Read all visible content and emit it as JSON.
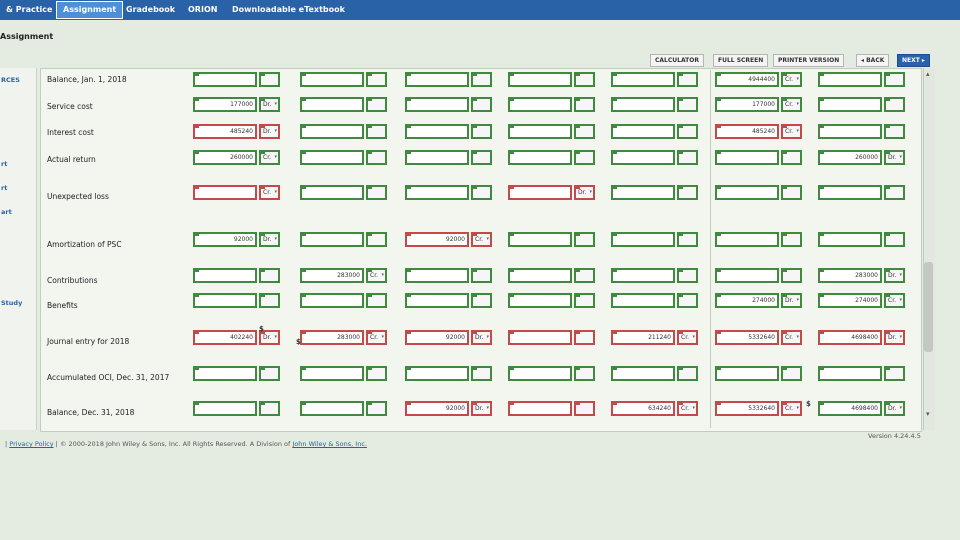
{
  "nav": {
    "tabs": [
      "& Practice",
      "Assignment",
      "Gradebook",
      "ORION",
      "Downloadable eTextbook"
    ],
    "active_tab": "Assignment"
  },
  "page_title": "Assignment",
  "toolbar": {
    "calculator": "CALCULATOR",
    "full_screen": "FULL SCREEN",
    "printer_version": "PRINTER VERSION",
    "back": "◂ BACK",
    "next": "NEXT ▸"
  },
  "sidebar": {
    "items": [
      "RCES",
      "rt",
      "rt",
      "art",
      "Study"
    ]
  },
  "worksheet": {
    "row_labels": [
      "Balance, Jan. 1, 2018",
      "Service cost",
      "Interest cost",
      "Actual return",
      "Unexpected loss",
      "Amortization of PSC",
      "Contributions",
      "Benefits",
      "Journal entry for 2018",
      "Accumulated OCI, Dec. 31, 2017",
      "Balance, Dec. 31, 2018"
    ],
    "entries": [
      {
        "row": 0,
        "column": "pbo",
        "value": "4944400",
        "side": "Cr."
      },
      {
        "row": 1,
        "column": "pension_expense",
        "value": "177000",
        "side": "Dr."
      },
      {
        "row": 1,
        "column": "pbo",
        "value": "177000",
        "side": "Cr."
      },
      {
        "row": 2,
        "column": "pension_expense",
        "value": "485240",
        "side": "Dr."
      },
      {
        "row": 2,
        "column": "pbo",
        "value": "485240",
        "side": "Cr."
      },
      {
        "row": 3,
        "column": "pension_expense",
        "value": "260000",
        "side": "Cr."
      },
      {
        "row": 3,
        "column": "plan_assets",
        "value": "260000",
        "side": "Dr."
      },
      {
        "row": 4,
        "column": "pension_expense",
        "value": "",
        "side": "Cr."
      },
      {
        "row": 4,
        "column": "oci_gain_loss",
        "value": "",
        "side": "Dr."
      },
      {
        "row": 5,
        "column": "pension_expense",
        "value": "92000",
        "side": "Dr."
      },
      {
        "row": 5,
        "column": "oci_psc",
        "value": "92000",
        "side": "Cr."
      },
      {
        "row": 6,
        "column": "cash",
        "value": "283000",
        "side": "Cr."
      },
      {
        "row": 6,
        "column": "plan_assets",
        "value": "283000",
        "side": "Dr."
      },
      {
        "row": 7,
        "column": "pbo",
        "value": "274000",
        "side": "Dr."
      },
      {
        "row": 7,
        "column": "plan_assets",
        "value": "274000",
        "side": "Cr."
      },
      {
        "row": 8,
        "column": "pension_expense",
        "value": "402240",
        "side": "Dr."
      },
      {
        "row": 8,
        "column": "cash",
        "value": "283000",
        "side": "Cr."
      },
      {
        "row": 8,
        "column": "oci_psc",
        "value": "92000",
        "side": "Dr."
      },
      {
        "row": 8,
        "column": "pension_asset_liability",
        "value": "211240",
        "side": "Cr."
      },
      {
        "row": 8,
        "column": "pbo",
        "value": "5332640",
        "side": "Cr."
      },
      {
        "row": 8,
        "column": "plan_assets",
        "value": "4698400",
        "side": "Dr."
      },
      {
        "row": 10,
        "column": "oci_psc",
        "value": "92000",
        "side": "Dr."
      },
      {
        "row": 10,
        "column": "pension_asset_liability",
        "value": "634240",
        "side": "Cr."
      },
      {
        "row": 10,
        "column": "pbo",
        "value": "5332640",
        "side": "Cr."
      },
      {
        "row": 10,
        "column": "plan_assets",
        "value": "4698400",
        "side": "Dr."
      }
    ],
    "markers": [
      "$",
      "$",
      "$"
    ]
  },
  "footer": {
    "separator": "|",
    "privacy": "Privacy Policy",
    "copyright": "© 2000-2018 John Wiley & Sons, Inc. All Rights Reserved. A Division of",
    "company": "John Wiley & Sons, Inc.",
    "version": "Version 4.24.4.5"
  },
  "icons": {
    "check": "check-icon",
    "error": "x-icon",
    "dropdown": "chevron-down-icon",
    "scroll_up": "scroll-up-icon",
    "scroll_down": "scroll-down-icon"
  },
  "colors": {
    "nav_blue": "#2a62a8",
    "correct_green": "#3f8a3f",
    "error_red": "#c44a4a"
  }
}
